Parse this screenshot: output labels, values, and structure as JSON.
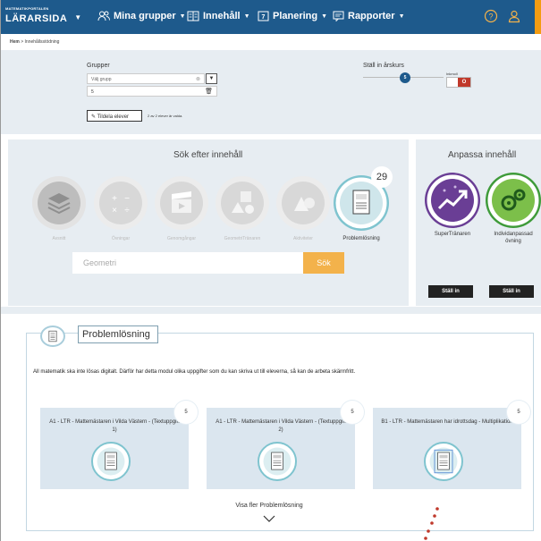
{
  "nav": {
    "brand_small": "MATEMATIKPORTALEN",
    "brand": "LÄRARSIDA",
    "items": [
      {
        "label": "Mina grupper"
      },
      {
        "label": "Innehåll"
      },
      {
        "label": "Planering"
      },
      {
        "label": "Rapporter"
      }
    ]
  },
  "breadcrumb": {
    "home": "Hem",
    "sep": ">",
    "current": "Innehållsstödning"
  },
  "groups": {
    "label": "Grupper",
    "select_placeholder": "Välj grupp",
    "count": "5",
    "assign_label": "Tildela elever",
    "assign_note": "2 av 2 elever är valda."
  },
  "grade": {
    "label": "Ställ in årskurs",
    "value": "5",
    "toggle_label": "Inkmoll",
    "toggle_state": "O"
  },
  "search": {
    "title": "Sök efter innehåll",
    "categories": [
      {
        "name": "Avsnitt"
      },
      {
        "name": "Övningar"
      },
      {
        "name": "Genomgångar"
      },
      {
        "name": "GeometriTränaren"
      },
      {
        "name": "Aktiviteter"
      },
      {
        "name": "Problemlösning",
        "count": "29"
      }
    ],
    "input_value": "Geometri",
    "button": "Sök"
  },
  "adapt": {
    "title": "Anpassa innehåll",
    "items": [
      {
        "name": "SuperTränaren",
        "button": "Ställ in"
      },
      {
        "name": "Individanpassad övning",
        "button": "Ställ in"
      }
    ]
  },
  "problem": {
    "title": "Problemlösning",
    "description": "All matematik ska inte lösas digitalt. Därför har detta modul olika uppgifter som du kan skriva ut till eleverna, så kan de arbeta skärmfritt.",
    "cards": [
      {
        "title": "A1 - LTR - Mattemästaren i Vilda Västern - (Textuppgift 1)",
        "badge": "5"
      },
      {
        "title": "A1 - LTR - Mattemästaren i Vilda Västern - (Textuppgift 2)",
        "badge": "5"
      },
      {
        "title": "B1 - LTR - Mattemästaren har idrottsdag - Multiplikation",
        "badge": "5"
      }
    ],
    "more": "Visa fler Problemlösning"
  },
  "colors": {
    "nav": "#1e5a8c",
    "accent": "#f3b24b",
    "panel": "#e7edf2",
    "teal": "#7fc4cf"
  }
}
